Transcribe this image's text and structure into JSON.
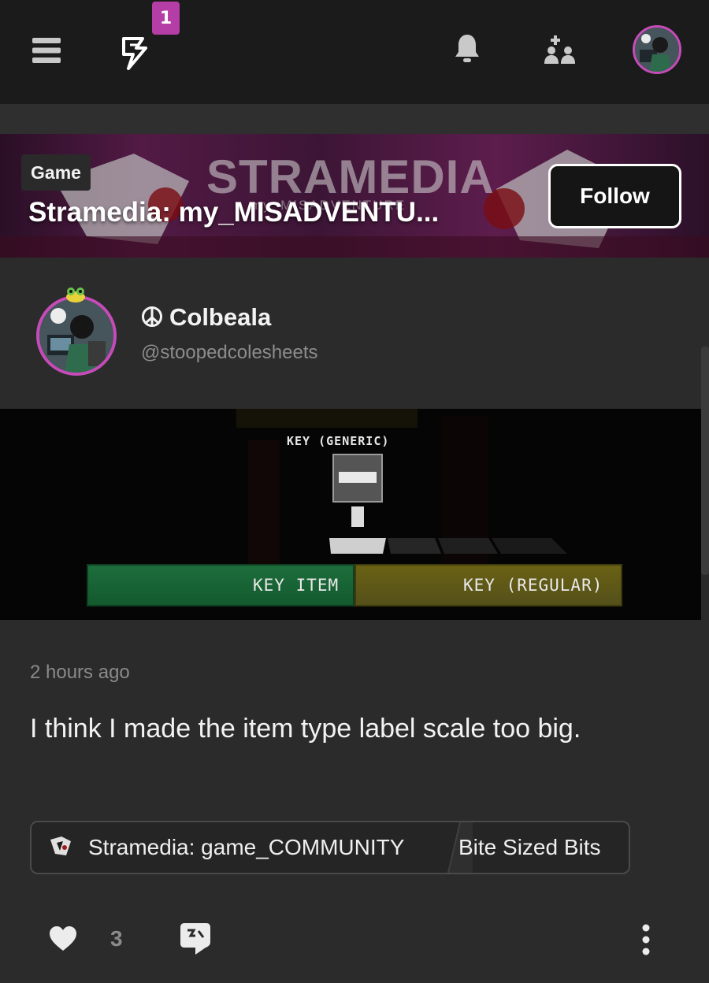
{
  "topbar": {
    "notification_count": "1",
    "icons": [
      "menu-icon",
      "bolt-icon",
      "bell-icon",
      "people-icon",
      "avatar"
    ]
  },
  "community": {
    "tag": "Game",
    "title": "Stramedia: my_MISADVENTU...",
    "banner_logo_text": "STRAMEDIA",
    "banner_sub_text": "my_MISADVENTURE",
    "follow_label": "Follow"
  },
  "author": {
    "name": "Colbeala",
    "handle": "@stoopedcolesheets"
  },
  "media": {
    "item_label": "KEY (GENERIC)",
    "type_label": "KEY ITEM",
    "subtype_label": "KEY (REGULAR)"
  },
  "post": {
    "time": "2 hours ago",
    "text": "I think I made the item type label scale too big.",
    "community_tag": "Stramedia: game_COMMUNITY",
    "topic_tag": "Bite Sized Bits",
    "like_count": "3"
  },
  "colors": {
    "accent": "#c64bb8",
    "badge": "#b53ea6",
    "background": "#2b2b2c",
    "topbar": "#1b1b1c"
  }
}
